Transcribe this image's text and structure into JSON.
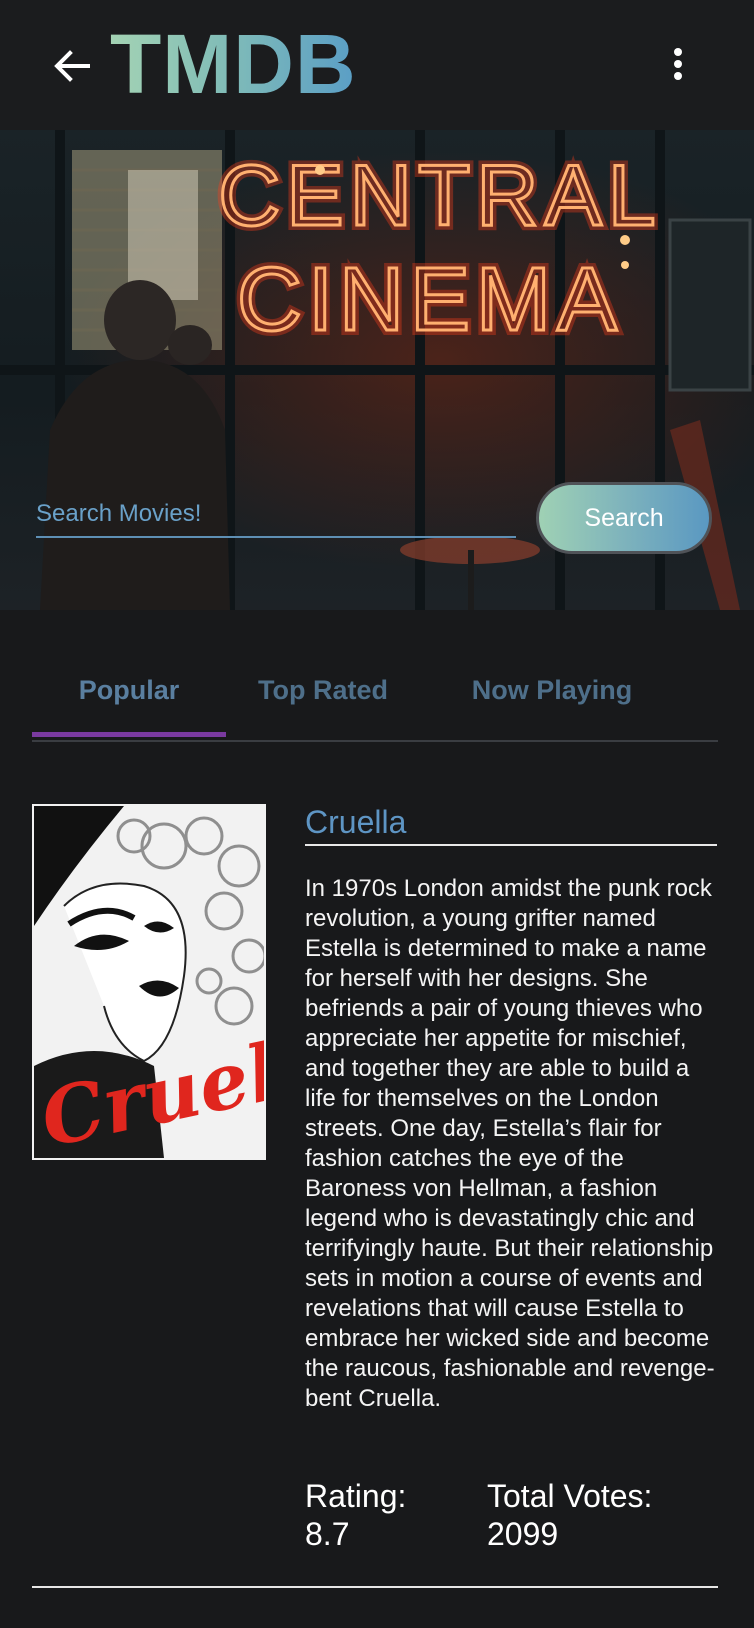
{
  "appbar": {
    "title": "TMDB",
    "back_icon": "arrow-left-icon",
    "menu_icon": "more-vertical-icon"
  },
  "hero": {
    "neon_line1": "CENTRAL",
    "neon_line2": "CINEMA",
    "search_placeholder": "Search Movies!",
    "search_button": "Search"
  },
  "tabs": [
    {
      "label": "Popular",
      "active": true
    },
    {
      "label": "Top Rated",
      "active": false
    },
    {
      "label": "Now Playing",
      "active": false
    }
  ],
  "movie": {
    "title": "Cruella",
    "poster_text": "Cruella",
    "overview": "In 1970s London amidst the punk rock revolution, a young grifter named Estella is determined to make a name for herself with her designs. She befriends a pair of young thieves who appreciate her appetite for mischief, and together they are able to build a life for themselves on the London streets. One day, Estella’s flair for fashion catches the eye of the Baroness von Hellman, a fashion legend who is devastatingly chic and terrifyingly haute. But their relationship sets in motion a course of events and revelations that will cause Estella to embrace her wicked side and become the raucous, fashionable and revenge-bent Cruella.",
    "rating_label": "Rating:",
    "rating_value": "8.7",
    "votes_label": "Total Votes:",
    "votes_value": "2099"
  },
  "colors": {
    "background": "#18191b",
    "accent_blue": "#5e95c4",
    "tab_indicator": "#7a3aa0",
    "neon": "#ff6a2b"
  }
}
